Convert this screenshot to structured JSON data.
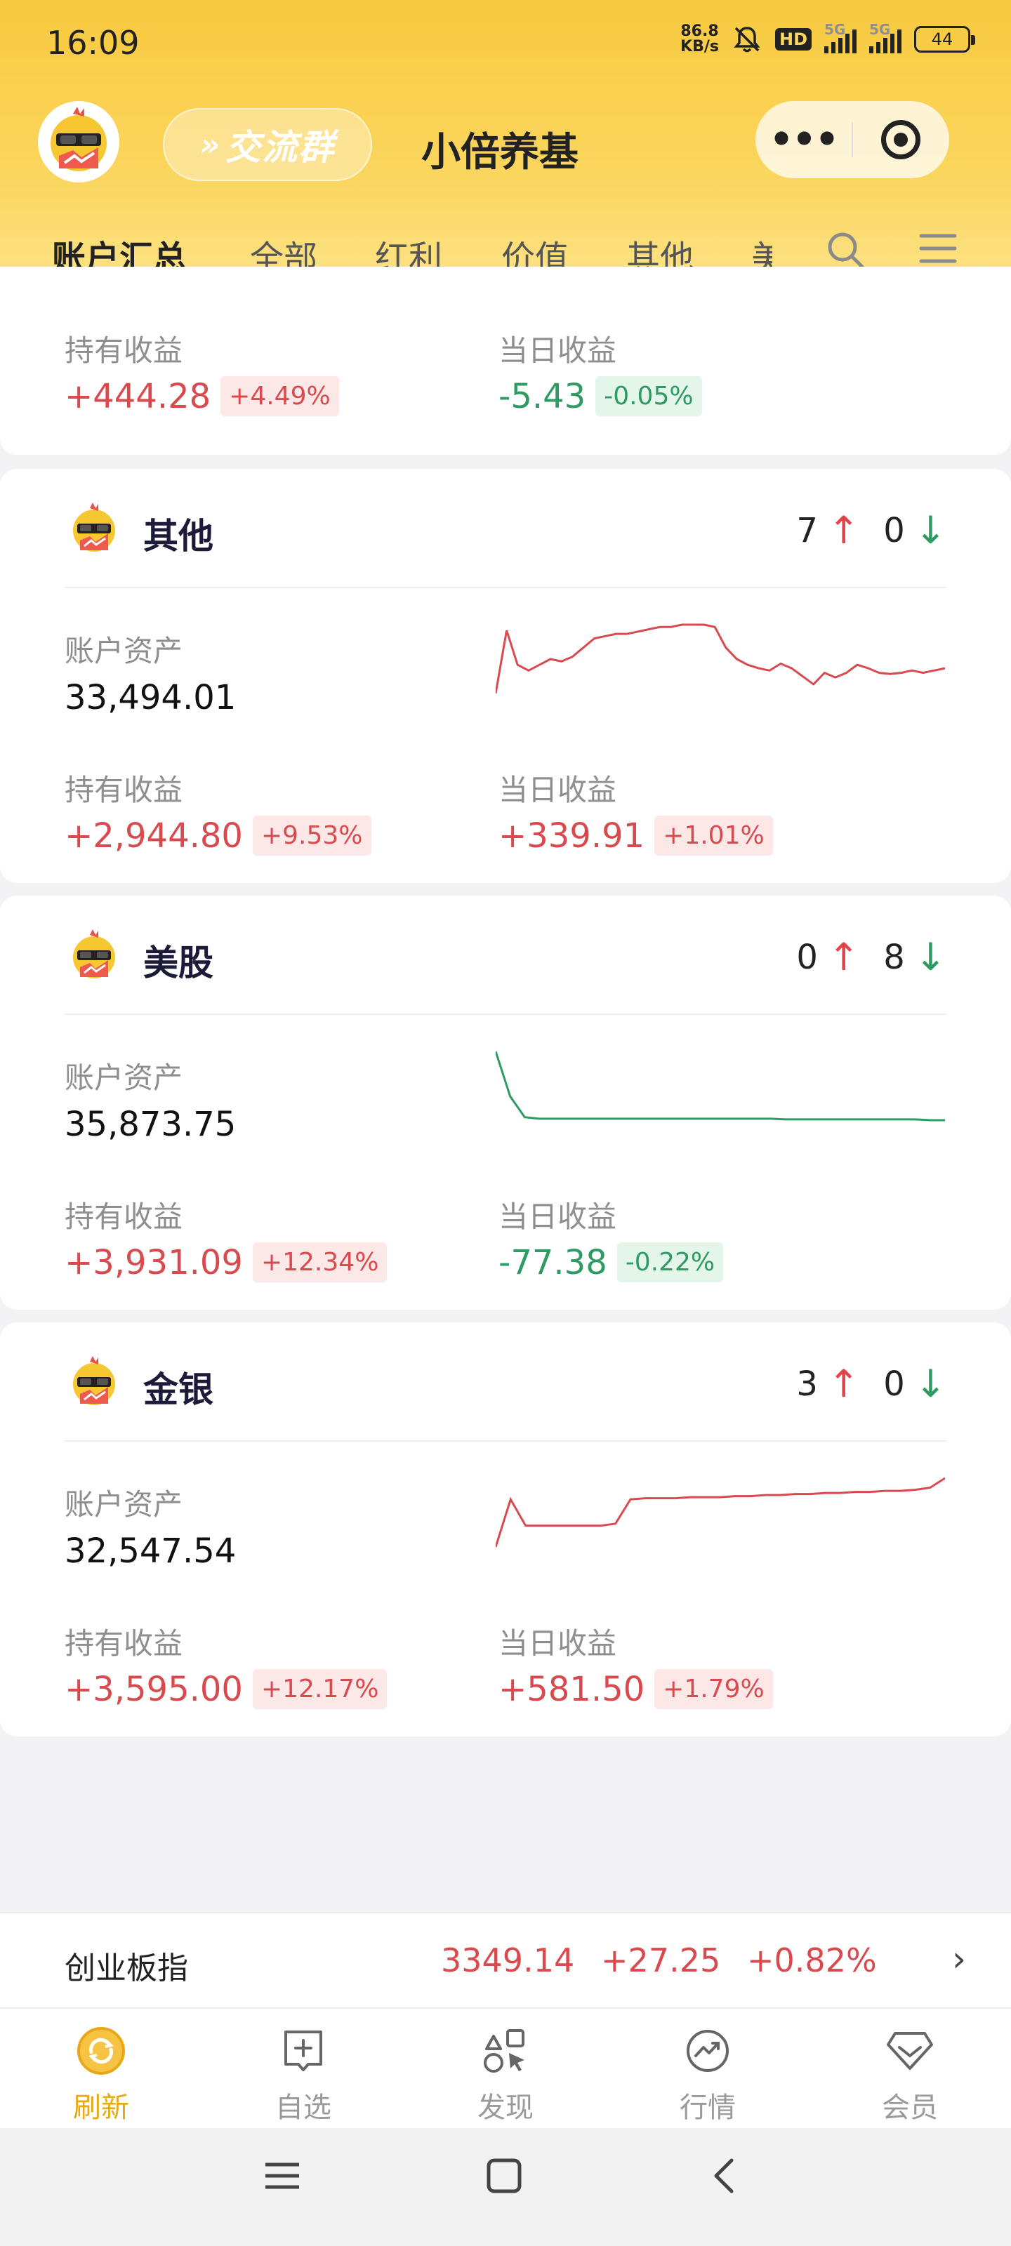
{
  "status_bar": {
    "time": "16:09",
    "speed_value": "86.8",
    "speed_unit": "KB/s",
    "hd": "HD",
    "net1": "5G",
    "net2": "5G",
    "battery": "44"
  },
  "header": {
    "group_label": "交流群",
    "group_arrow": "»",
    "title": "小倍养基",
    "more_label": "•••"
  },
  "tabs": [
    "账户汇总",
    "全部",
    "红利",
    "价值",
    "其他",
    "美"
  ],
  "top_partial": {
    "hold_label": "持有收益",
    "hold_value": "+444.28",
    "hold_pct": "+4.49%",
    "day_label": "当日收益",
    "day_value": "-5.43",
    "day_pct": "-0.05%"
  },
  "cards": [
    {
      "name": "其他",
      "up_count": "7",
      "down_count": "0",
      "asset_label": "账户资产",
      "asset_value": "33,494.01",
      "hold_label": "持有收益",
      "hold_value": "+2,944.80",
      "hold_pct": "+9.53%",
      "day_label": "当日收益",
      "day_value": "+339.91",
      "day_pct": "+1.01%",
      "sparkline": [
        30,
        85,
        55,
        50,
        55,
        60,
        58,
        62,
        70,
        78,
        80,
        82,
        82,
        84,
        86,
        88,
        88,
        90,
        90,
        90,
        88,
        70,
        60,
        55,
        52,
        50,
        56,
        52,
        45,
        38,
        48,
        44,
        48,
        55,
        52,
        48,
        47,
        48,
        50,
        48,
        50,
        52
      ],
      "trend": "up"
    },
    {
      "name": "美股",
      "up_count": "0",
      "down_count": "8",
      "asset_label": "账户资产",
      "asset_value": "35,873.75",
      "hold_label": "持有收益",
      "hold_value": "+3,931.09",
      "hold_pct": "+12.34%",
      "day_label": "当日收益",
      "day_value": "-77.38",
      "day_pct": "-0.22%",
      "sparkline": [
        100,
        40,
        12,
        10,
        10,
        10,
        10,
        10,
        10,
        10,
        10,
        10,
        10,
        10,
        10,
        10,
        10,
        10,
        10,
        10,
        9,
        9,
        9,
        9,
        9,
        9,
        9,
        9,
        9,
        9,
        8,
        8
      ],
      "trend": "down"
    },
    {
      "name": "金银",
      "up_count": "3",
      "down_count": "0",
      "asset_label": "账户资产",
      "asset_value": "32,547.54",
      "hold_label": "持有收益",
      "hold_value": "+3,595.00",
      "hold_pct": "+12.17%",
      "day_label": "当日收益",
      "day_value": "+581.50",
      "day_pct": "+1.79%",
      "sparkline": [
        10,
        55,
        30,
        30,
        30,
        30,
        30,
        30,
        32,
        55,
        56,
        56,
        56,
        57,
        57,
        57,
        58,
        58,
        59,
        59,
        60,
        60,
        61,
        61,
        62,
        62,
        63,
        63,
        64,
        66,
        75
      ],
      "trend": "up"
    }
  ],
  "index_bar": {
    "name": "创业板指",
    "value": "3349.14",
    "change": "+27.25",
    "pct": "+0.82%",
    "chevron": "›"
  },
  "bottom_nav": [
    {
      "label": "刷新",
      "icon": "refresh-icon",
      "active": true
    },
    {
      "label": "自选",
      "icon": "add-favorite-icon",
      "active": false
    },
    {
      "label": "发现",
      "icon": "discover-icon",
      "active": false
    },
    {
      "label": "行情",
      "icon": "market-icon",
      "active": false
    },
    {
      "label": "会员",
      "icon": "vip-diamond-icon",
      "active": false
    }
  ],
  "colors": {
    "header_yellow": "#f8c93f",
    "rise_red": "#d94a4e",
    "fall_green": "#2e9b63",
    "active_nav": "#e6a817"
  }
}
